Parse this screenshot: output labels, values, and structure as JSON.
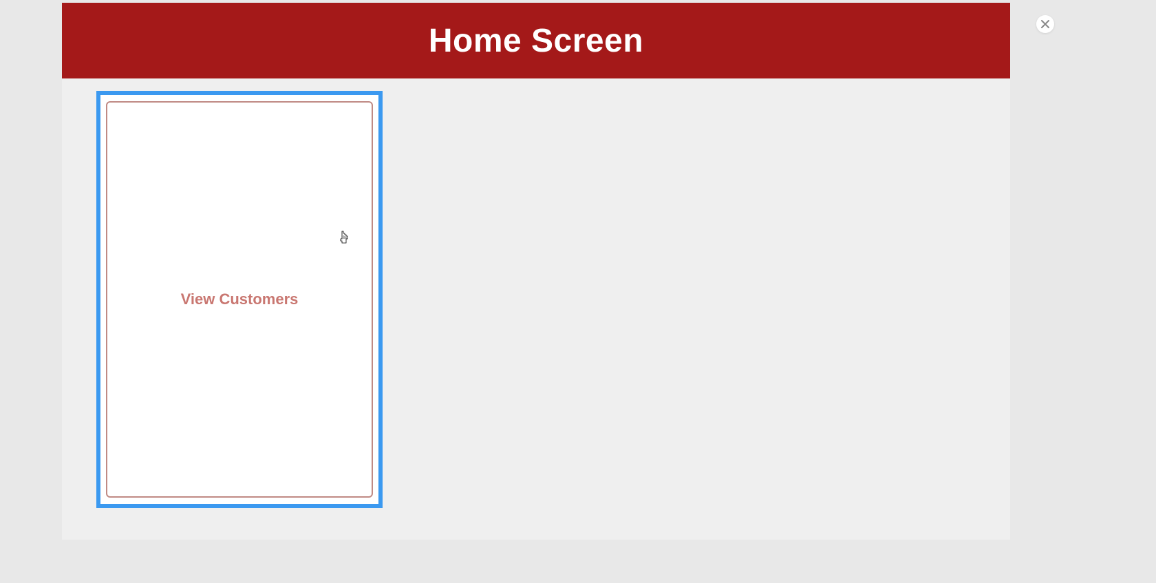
{
  "header": {
    "title": "Home Screen"
  },
  "cards": [
    {
      "label": "View Customers"
    }
  ],
  "colors": {
    "header_bg": "#a41919",
    "card_border_selected": "#3b99f0",
    "card_inner_border": "#c08a84",
    "card_text": "#c97771"
  }
}
